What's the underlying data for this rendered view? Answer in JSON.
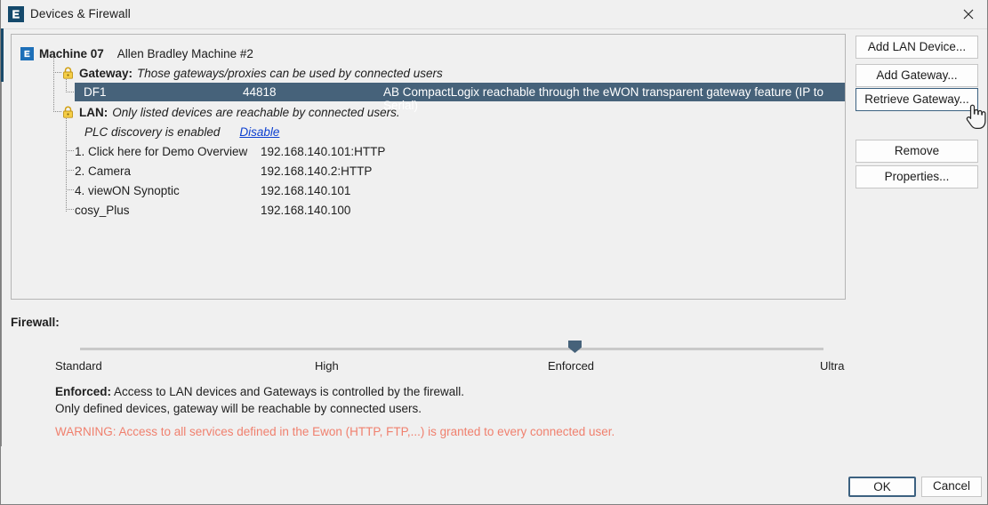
{
  "window": {
    "title": "Devices & Firewall",
    "app_icon": "ewon-e-icon",
    "close_icon": "close-icon"
  },
  "device_tree": {
    "machine": {
      "icon": "ewon-e-icon",
      "name": "Machine 07",
      "description": "Allen Bradley Machine #2"
    },
    "gateway_group": {
      "icon": "lock-icon",
      "label": "Gateway:",
      "description": "Those gateways/proxies can be used by connected users"
    },
    "gateway_entry": {
      "name": "DF1",
      "port": "44818",
      "description": "AB CompactLogix reachable through the eWON transparent gateway feature (IP to Serial)",
      "selected": true
    },
    "lan_group": {
      "icon": "lock-icon",
      "label": "LAN:",
      "description": "Only listed devices are reachable by connected users."
    },
    "plc_discovery": {
      "status_text": "PLC discovery is enabled",
      "action_link": "Disable"
    },
    "lan_devices": [
      {
        "name": "1. Click here for Demo Overview",
        "address": "192.168.140.101:HTTP"
      },
      {
        "name": "2. Camera",
        "address": "192.168.140.2:HTTP"
      },
      {
        "name": "4. viewON Synoptic",
        "address": "192.168.140.101"
      },
      {
        "name": "cosy_Plus",
        "address": "192.168.140.100"
      }
    ]
  },
  "side_buttons": {
    "add_lan_device": "Add LAN Device...",
    "add_gateway": "Add Gateway...",
    "retrieve_gateway": "Retrieve Gateway...",
    "remove": "Remove",
    "properties": "Properties..."
  },
  "firewall": {
    "label": "Firewall:",
    "levels": [
      "Standard",
      "High",
      "Enforced",
      "Ultra"
    ],
    "selected_level": "Enforced",
    "selected_index": 2,
    "description_bold": "Enforced:",
    "description_line1": " Access to LAN devices and Gateways is controlled by the firewall.",
    "description_line2": "Only defined devices, gateway will be reachable by connected users.",
    "warning": "WARNING: Access to all services defined in the Ewon (HTTP, FTP,...) is granted to every connected user.",
    "warning_color": "#f0806e",
    "accent_color": "#46627a"
  },
  "footer": {
    "ok": "OK",
    "cancel": "Cancel"
  },
  "cursor": {
    "type": "pointing-hand-cursor"
  }
}
